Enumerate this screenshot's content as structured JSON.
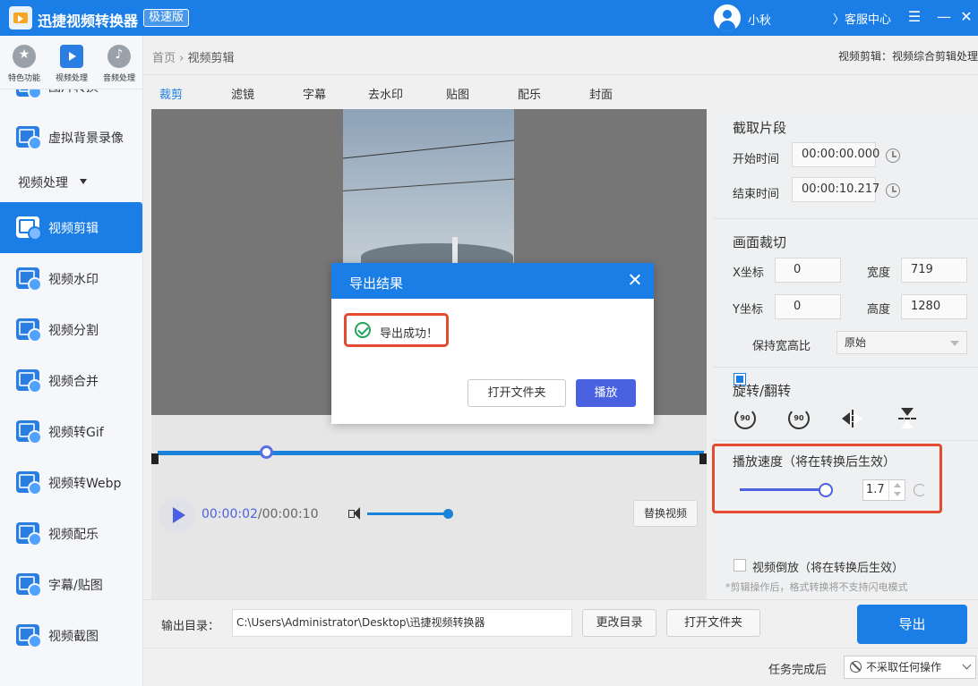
{
  "app": {
    "title": "迅捷视频转换器",
    "edition": "极速版",
    "username": "小秋",
    "service": "〉客服中心"
  },
  "categories": [
    {
      "label": "特色功能",
      "icon": "star-icon"
    },
    {
      "label": "视频处理",
      "icon": "video-icon"
    },
    {
      "label": "音频处理",
      "icon": "music-icon"
    }
  ],
  "sidebar": {
    "items_top": [
      {
        "label": "图片转换"
      },
      {
        "label": "虚拟背景录像"
      }
    ],
    "section_label": "视频处理",
    "items": [
      {
        "label": "视频剪辑",
        "active": true
      },
      {
        "label": "视频水印"
      },
      {
        "label": "视频分割"
      },
      {
        "label": "视频合并"
      },
      {
        "label": "视频转Gif"
      },
      {
        "label": "视频转Webp"
      },
      {
        "label": "视频配乐"
      },
      {
        "label": "字幕/贴图"
      },
      {
        "label": "视频截图"
      }
    ]
  },
  "breadcrumb": {
    "home": "首页",
    "sep": "›",
    "current": "视频剪辑",
    "desc": "视频剪辑：视频综合剪辑处理"
  },
  "tabs": [
    "裁剪",
    "滤镜",
    "字幕",
    "去水印",
    "贴图",
    "配乐",
    "封面"
  ],
  "player": {
    "current_time": "00:00:02",
    "total_time": "/00:00:10",
    "replace_label": "替换视频",
    "progress": 0.2,
    "volume": 0.95
  },
  "clip": {
    "title": "截取片段",
    "start_label": "开始时间",
    "start_value": "00:00:00.000",
    "end_label": "结束时间",
    "end_value": "00:00:10.217"
  },
  "crop": {
    "title": "画面裁切",
    "x_label": "X坐标",
    "x_value": "0",
    "width_label": "宽度",
    "width_value": "719",
    "y_label": "Y坐标",
    "y_value": "0",
    "height_label": "高度",
    "height_value": "1280",
    "keep_ratio_label": "保持宽高比",
    "keep_ratio_checked": true,
    "ratio_value": "原始"
  },
  "rotate": {
    "title": "旋转/翻转",
    "ccw_label": "90",
    "cw_label": "90"
  },
  "speed": {
    "title": "播放速度（将在转换后生效）",
    "value": "1.7",
    "slider_fraction": 0.75
  },
  "reverse": {
    "label": "视频倒放（将在转换后生效）",
    "checked": false
  },
  "note": "*剪辑操作后，格式转换将不支持闪电模式",
  "output": {
    "label": "输出目录：",
    "path": "C:\\Users\\Administrator\\Desktop\\迅捷视频转换器",
    "change_label": "更改目录",
    "open_label": "打开文件夹",
    "export_label": "导出"
  },
  "after_task": {
    "label": "任务完成后",
    "value": "不采取任何操作"
  },
  "modal": {
    "title": "导出结果",
    "message": "导出成功！",
    "open_folder_label": "打开文件夹",
    "play_label": "播放"
  },
  "colors": {
    "primary": "#1a7ee6",
    "accent": "#4a62e0",
    "highlight": "#e34a2f",
    "success": "#22a45a"
  }
}
